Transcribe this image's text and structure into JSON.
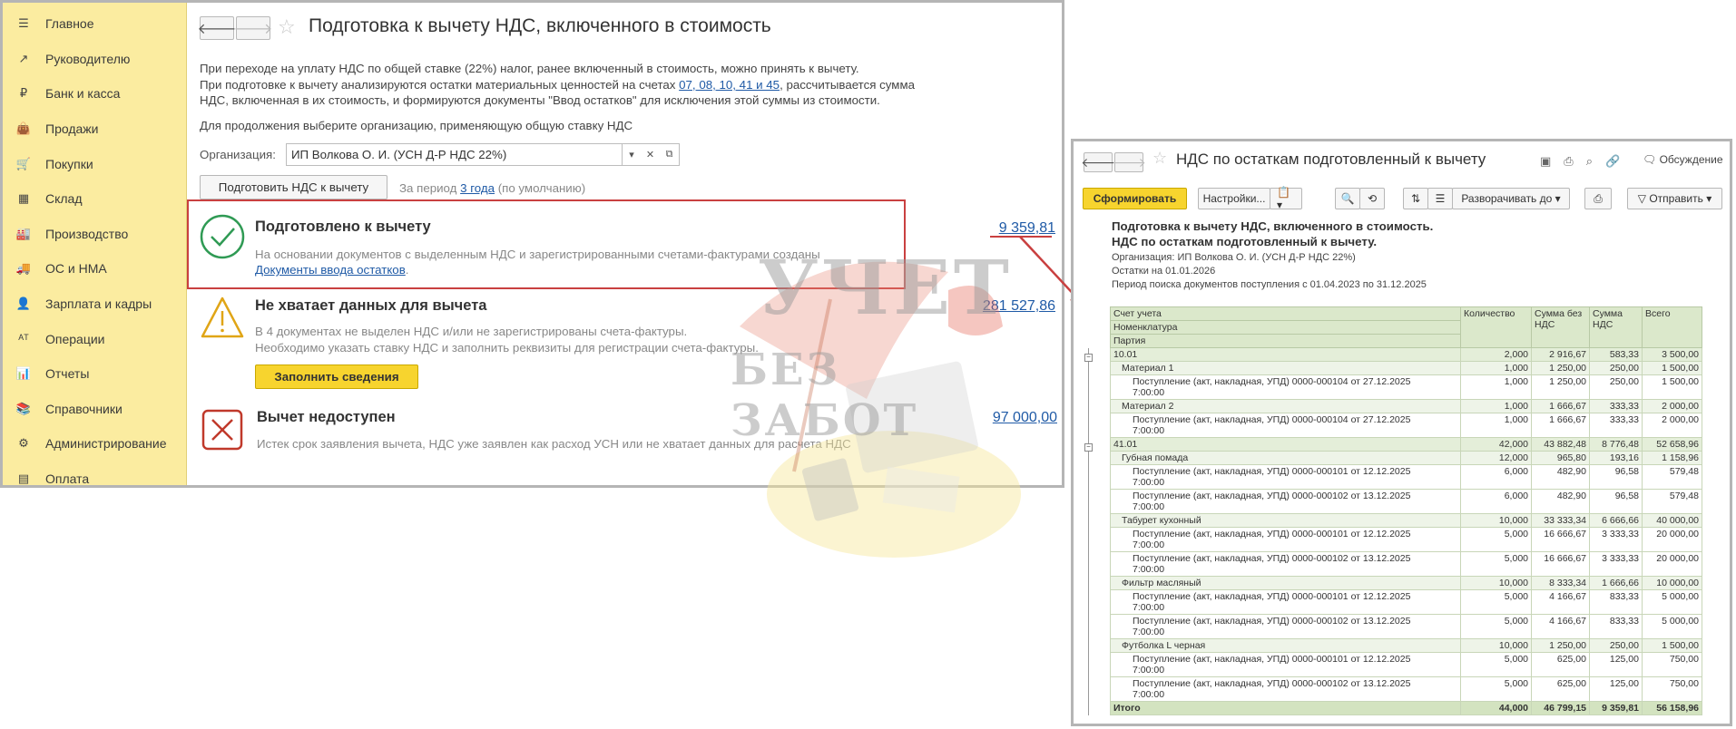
{
  "sidebar": {
    "items": [
      {
        "label": "Главное",
        "icon": "menu-icon"
      },
      {
        "label": "Руководителю",
        "icon": "chart-trend-icon"
      },
      {
        "label": "Банк и касса",
        "icon": "ruble-coin-icon"
      },
      {
        "label": "Продажи",
        "icon": "shopping-bag-icon"
      },
      {
        "label": "Покупки",
        "icon": "cart-icon"
      },
      {
        "label": "Склад",
        "icon": "warehouse-grid-icon"
      },
      {
        "label": "Производство",
        "icon": "factory-icon"
      },
      {
        "label": "ОС и НМА",
        "icon": "truck-icon"
      },
      {
        "label": "Зарплата и кадры",
        "icon": "person-icon"
      },
      {
        "label": "Операции",
        "icon": "dt-kt-icon"
      },
      {
        "label": "Отчеты",
        "icon": "bar-chart-icon"
      },
      {
        "label": "Справочники",
        "icon": "books-icon"
      },
      {
        "label": "Администрирование",
        "icon": "gear-icon"
      },
      {
        "label": "Оплата",
        "icon": "payment-icon"
      }
    ]
  },
  "main": {
    "title": "Подготовка к вычету НДС, включенного в стоимость",
    "desc_line1": "При переходе на уплату НДС по общей ставке (22%) налог, ранее включенный в стоимость, можно принять к вычету.",
    "desc_line2_pre": "При подготовке к вычету анализируются остатки материальных ценностей на счетах ",
    "desc_line2_accounts": "07, 08, 10, 41 и 45",
    "desc_line2_post": ", рассчитывается сумма",
    "desc_line3": "НДС, включенная в их стоимость, и формируются документы \"Ввод остатков\" для исключения этой суммы из стоимости.",
    "desc_line4": "Для продолжения выберите организацию, применяющую общую ставку НДС",
    "org_label": "Организация:",
    "org_value": "ИП Волкова О. И. (УСН Д-Р НДС 22%)",
    "prepare_button": "Подготовить НДС к вычету",
    "period_pre": "За период ",
    "period_link": "3 года",
    "period_post": " (по умолчанию)",
    "blocks": [
      {
        "title": "Подготовлено к вычету",
        "text1": "На основании документов с выделенным НДС и зарегистрированными счетами-фактурами созданы",
        "link": "Документы ввода остатков",
        "link_suffix": ".",
        "amount": "9 359,81",
        "status_color": "#2f9a54"
      },
      {
        "title": "Не хватает данных для вычета",
        "text1": "В 4 документах не выделен НДС и/или не зарегистрированы счета-фактуры.",
        "text2": "Необходимо указать ставку НДС и заполнить реквизиты для регистрации счета-фактуры.",
        "button": "Заполнить сведения",
        "amount": "281 527,86",
        "status_color": "#e0a516"
      },
      {
        "title": "Вычет недоступен",
        "text1": "Истек срок заявления вычета, НДС уже заявлен как расход УСН или не хватает данных для расчета НДС",
        "amount": "97 000,00",
        "status_color": "#c0392b"
      }
    ]
  },
  "watermark": {
    "line1": "УЧЕТ",
    "line2": "БЕЗ ЗАБОТ"
  },
  "report": {
    "title": "НДС по остаткам подготовленный к вычету",
    "discuss": "Обсуждение",
    "toolbar": {
      "generate": "Сформировать",
      "settings": "Настройки...",
      "expand": "Разворачивать до",
      "send": "Отправить"
    },
    "head1": "Подготовка к вычету НДС, включенного в стоимость.",
    "head2": "НДС по остаткам подготовленный к вычету.",
    "meta1": "Организация: ИП Волкова О. И. (УСН Д-Р НДС 22%)",
    "meta2": "Остатки на 01.01.2026",
    "meta3": "Период поиска документов поступления с 01.04.2023 по 31.12.2025",
    "columns": {
      "c0a": "Счет учета",
      "c0b": "Номенклатура",
      "c0c": "Партия",
      "c1": "Количество",
      "c2": "Сумма без НДС",
      "c3": "Сумма НДС",
      "c4": "Всего"
    },
    "rows": [
      {
        "lvl": 0,
        "name": "10.01",
        "qty": "2,000",
        "net": "2 916,67",
        "vat": "583,33",
        "total": "3 500,00"
      },
      {
        "lvl": 1,
        "name": "Материал 1",
        "qty": "1,000",
        "net": "1 250,00",
        "vat": "250,00",
        "total": "1 500,00"
      },
      {
        "lvl": 2,
        "name": "Поступление (акт, накладная, УПД) 0000-000104 от 27.12.2025",
        "name2": "7:00:00",
        "qty": "1,000",
        "net": "1 250,00",
        "vat": "250,00",
        "total": "1 500,00"
      },
      {
        "lvl": 1,
        "name": "Материал 2",
        "qty": "1,000",
        "net": "1 666,67",
        "vat": "333,33",
        "total": "2 000,00"
      },
      {
        "lvl": 2,
        "name": "Поступление (акт, накладная, УПД) 0000-000104 от 27.12.2025",
        "name2": "7:00:00",
        "qty": "1,000",
        "net": "1 666,67",
        "vat": "333,33",
        "total": "2 000,00"
      },
      {
        "lvl": 0,
        "name": "41.01",
        "qty": "42,000",
        "net": "43 882,48",
        "vat": "8 776,48",
        "total": "52 658,96"
      },
      {
        "lvl": 1,
        "name": "Губная помада",
        "qty": "12,000",
        "net": "965,80",
        "vat": "193,16",
        "total": "1 158,96"
      },
      {
        "lvl": 2,
        "name": "Поступление (акт, накладная, УПД) 0000-000101 от 12.12.2025",
        "name2": "7:00:00",
        "qty": "6,000",
        "net": "482,90",
        "vat": "96,58",
        "total": "579,48"
      },
      {
        "lvl": 2,
        "name": "Поступление (акт, накладная, УПД) 0000-000102 от 13.12.2025",
        "name2": "7:00:00",
        "qty": "6,000",
        "net": "482,90",
        "vat": "96,58",
        "total": "579,48"
      },
      {
        "lvl": 1,
        "name": "Табурет кухонный",
        "qty": "10,000",
        "net": "33 333,34",
        "vat": "6 666,66",
        "total": "40 000,00"
      },
      {
        "lvl": 2,
        "name": "Поступление (акт, накладная, УПД) 0000-000101 от 12.12.2025",
        "name2": "7:00:00",
        "qty": "5,000",
        "net": "16 666,67",
        "vat": "3 333,33",
        "total": "20 000,00"
      },
      {
        "lvl": 2,
        "name": "Поступление (акт, накладная, УПД) 0000-000102 от 13.12.2025",
        "name2": "7:00:00",
        "qty": "5,000",
        "net": "16 666,67",
        "vat": "3 333,33",
        "total": "20 000,00"
      },
      {
        "lvl": 1,
        "name": "Фильтр масляный",
        "qty": "10,000",
        "net": "8 333,34",
        "vat": "1 666,66",
        "total": "10 000,00"
      },
      {
        "lvl": 2,
        "name": "Поступление (акт, накладная, УПД) 0000-000101 от 12.12.2025",
        "name2": "7:00:00",
        "qty": "5,000",
        "net": "4 166,67",
        "vat": "833,33",
        "total": "5 000,00"
      },
      {
        "lvl": 2,
        "name": "Поступление (акт, накладная, УПД) 0000-000102 от 13.12.2025",
        "name2": "7:00:00",
        "qty": "5,000",
        "net": "4 166,67",
        "vat": "833,33",
        "total": "5 000,00"
      },
      {
        "lvl": 1,
        "name": "Футболка L черная",
        "qty": "10,000",
        "net": "1 250,00",
        "vat": "250,00",
        "total": "1 500,00"
      },
      {
        "lvl": 2,
        "name": "Поступление (акт, накладная, УПД) 0000-000101 от 12.12.2025",
        "name2": "7:00:00",
        "qty": "5,000",
        "net": "625,00",
        "vat": "125,00",
        "total": "750,00"
      },
      {
        "lvl": 2,
        "name": "Поступление (акт, накладная, УПД) 0000-000102 от 13.12.2025",
        "name2": "7:00:00",
        "qty": "5,000",
        "net": "625,00",
        "vat": "125,00",
        "total": "750,00"
      }
    ],
    "total": {
      "name": "Итого",
      "qty": "44,000",
      "net": "46 799,15",
      "vat": "9 359,81",
      "total": "56 158,96"
    }
  },
  "colors": {
    "accent_yellow": "#f7d42e",
    "sidebar_bg": "#fbeca0",
    "link": "#1f5aa6",
    "highlight_red": "#c94040"
  }
}
